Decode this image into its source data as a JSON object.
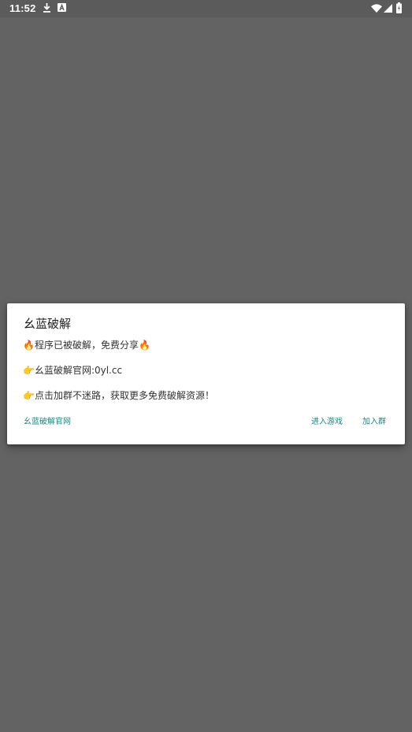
{
  "status_bar": {
    "time": "11:52",
    "icons": [
      "download-icon",
      "a-notification-icon",
      "wifi-icon",
      "cell-signal-icon",
      "battery-icon"
    ]
  },
  "dialog": {
    "title": "幺蓝破解",
    "messages": [
      "🔥程序已被破解，免费分享🔥",
      "👉幺蓝破解官网:0yl.cc",
      "👉点击加群不迷路，获取更多免费破解资源！"
    ],
    "buttons": {
      "website": "幺蓝破解官网",
      "enter_game": "进入游戏",
      "join_group": "加入群"
    },
    "accent_color": "#1a8a80"
  },
  "colors": {
    "scrim": "#636363",
    "status_bar": "#5b5b5b"
  }
}
